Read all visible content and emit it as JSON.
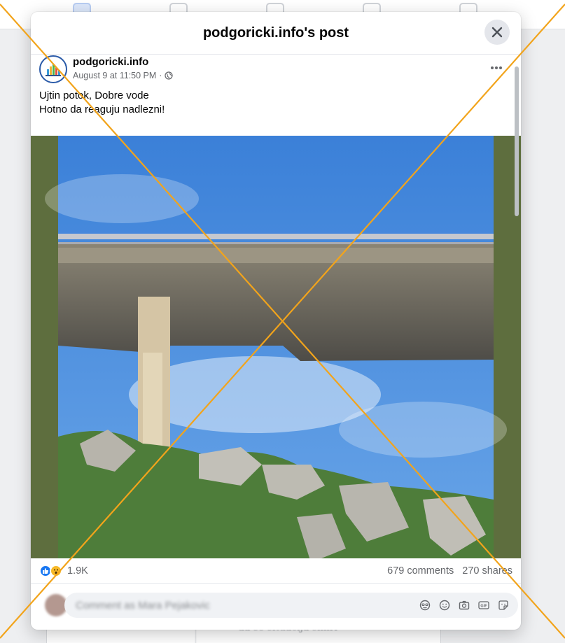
{
  "modal": {
    "title": "podgoricki.info's post"
  },
  "post": {
    "author": "podgoricki.info",
    "timestamp": "August 9 at 11:50 PM",
    "separator": "·",
    "text_line1": "Ujtin potok, Dobre vode",
    "text_line2": "Hotno da reaguju nadlezni!"
  },
  "stats": {
    "reactions": "1.9K",
    "comments": "679 comments",
    "shares": "270 shares",
    "reaction_types": [
      "like",
      "wow"
    ]
  },
  "comment": {
    "placeholder": "Comment as Mara Pejakovic"
  },
  "background": {
    "card_text": "da se situacija smiri"
  },
  "icons": [
    "close-icon",
    "more-icon",
    "globe-icon",
    "like-icon",
    "wow-icon",
    "avatar-sticker-icon",
    "emoji-icon",
    "camera-icon",
    "gif-icon",
    "sticker-icon"
  ],
  "colors": {
    "accent": "#1877f2",
    "overlay_x": "#f2a41b",
    "photo_border": "#5e6e3e"
  }
}
